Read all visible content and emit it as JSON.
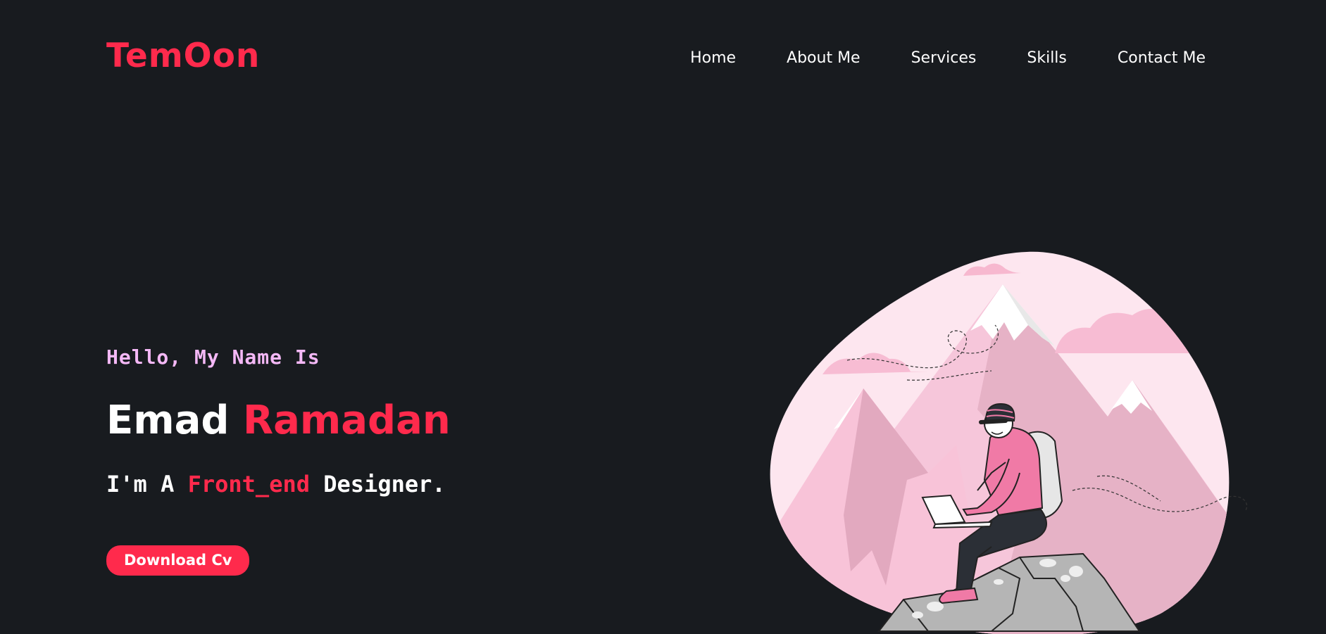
{
  "header": {
    "logo": "TemOon",
    "nav": [
      "Home",
      "About Me",
      "Services",
      "Skills",
      "Contact Me"
    ]
  },
  "hero": {
    "greeting": "Hello, My Name Is",
    "first_name": "Emad",
    "last_name": "Ramadan",
    "role_prefix": "I'm A ",
    "role_highlight": "Front_end",
    "role_suffix": " Designer.",
    "cta_label": "Download Cv"
  },
  "colors": {
    "background": "#181b1f",
    "accent": "#ff2a4c",
    "greeting": "#f4b8f6"
  },
  "illustration": "person-on-mountain-with-laptop"
}
